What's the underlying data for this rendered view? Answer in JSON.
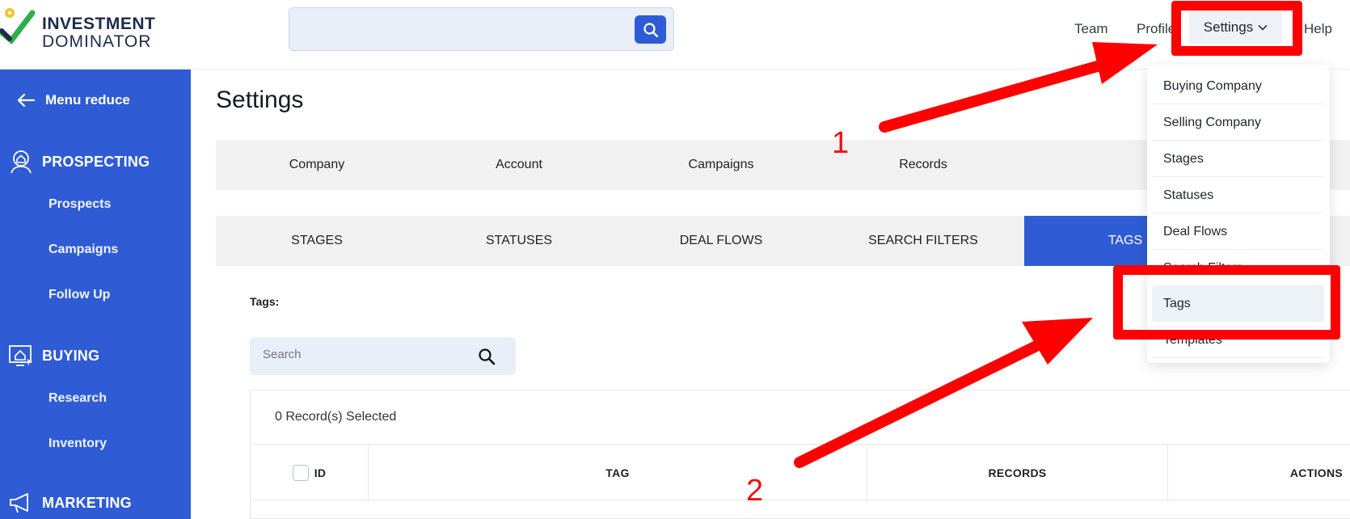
{
  "brand": {
    "line1": "INVESTMENT",
    "line2": "DOMINATOR"
  },
  "topnav": {
    "team": "Team",
    "profile": "Profile",
    "settings": "Settings",
    "help": "Help"
  },
  "sidebar": {
    "menu_reduce": "Menu reduce",
    "sections": [
      {
        "title": "PROSPECTING",
        "items": [
          "Prospects",
          "Campaigns",
          "Follow Up"
        ]
      },
      {
        "title": "BUYING",
        "items": [
          "Research",
          "Inventory"
        ]
      },
      {
        "title": "MARKETING",
        "items": []
      }
    ]
  },
  "page": {
    "title": "Settings"
  },
  "tabs": [
    "Company",
    "Account",
    "Campaigns",
    "Records"
  ],
  "subtabs": [
    "STAGES",
    "STATUSES",
    "DEAL FLOWS",
    "SEARCH FILTERS",
    "TAGS"
  ],
  "subtabs_active": "TAGS",
  "tags_section": {
    "label": "Tags:",
    "search_placeholder": "Search",
    "selected_count": "0 Record(s) Selected",
    "columns": [
      "ID",
      "TAG",
      "RECORDS",
      "ACTIONS"
    ]
  },
  "dropdown": {
    "items": [
      "Buying Company",
      "Selling Company",
      "Stages",
      "Statuses",
      "Deal Flows",
      "Search Filters",
      "Tags",
      "Templates"
    ],
    "active": "Tags"
  },
  "annotations": {
    "label1": "1",
    "label2": "2"
  },
  "colors": {
    "primary": "#2f5cd4",
    "annotation_red": "#ff0000"
  }
}
